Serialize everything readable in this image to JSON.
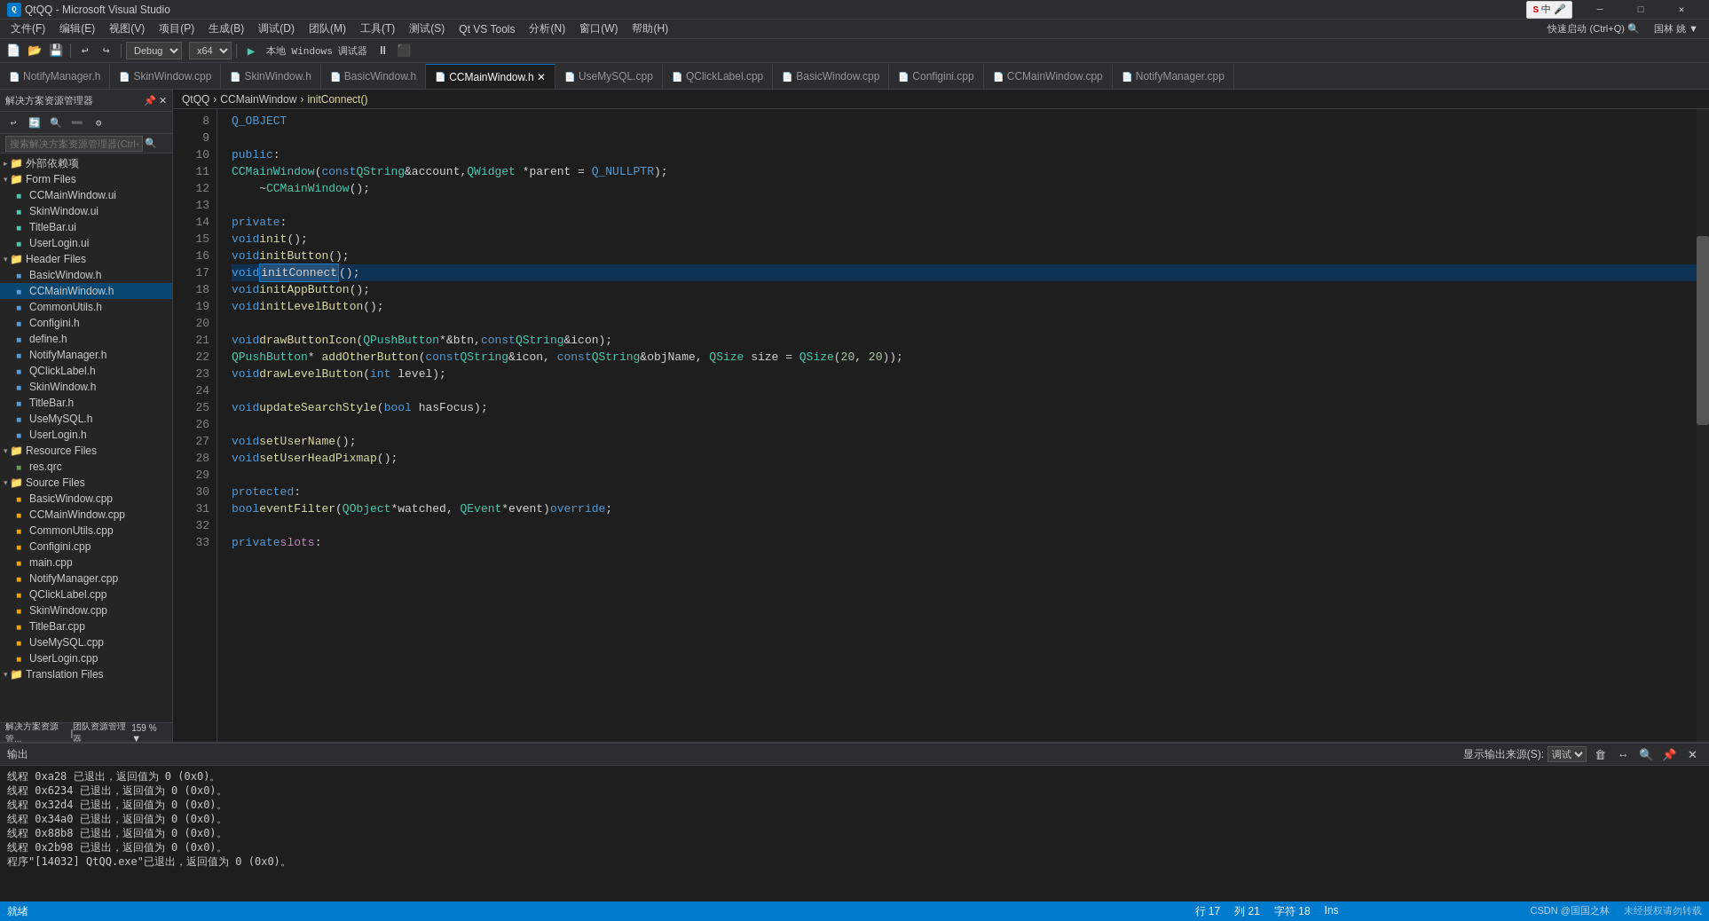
{
  "window": {
    "title": "QtQQ - Microsoft Visual Studio",
    "app_name": "QtQQ - Microsoft Visual Studio"
  },
  "title_bar": {
    "icon_text": "Q",
    "title": "QtQQ - Microsoft Visual Studio",
    "min_btn": "─",
    "max_btn": "□",
    "close_btn": "✕"
  },
  "menu_bar": {
    "items": [
      "文件(F)",
      "编辑(E)",
      "视图(V)",
      "项目(P)",
      "生成(B)",
      "调试(D)",
      "团队(M)",
      "工具(T)",
      "测试(S)",
      "Qt VS Tools",
      "分析(N)",
      "窗口(W)",
      "帮助(H)"
    ]
  },
  "toolbar": {
    "config": "Debug",
    "platform": "x64",
    "run_btn": "▶",
    "run_label": "本地 Windows 调试器"
  },
  "tabs": [
    {
      "label": "NotifyManager.h",
      "active": false,
      "modified": false
    },
    {
      "label": "SkinWindow.cpp",
      "active": false,
      "modified": false
    },
    {
      "label": "SkinWindow.h",
      "active": false,
      "modified": false
    },
    {
      "label": "BasicWindow.h",
      "active": false,
      "modified": false
    },
    {
      "label": "CCMainWindow.h",
      "active": true,
      "modified": true
    },
    {
      "label": "UseMySQL.cpp",
      "active": false,
      "modified": false
    },
    {
      "label": "QClickLabel.cpp",
      "active": false,
      "modified": false
    },
    {
      "label": "BasicWindow.cpp",
      "active": false,
      "modified": false
    },
    {
      "label": "Configini.cpp",
      "active": false,
      "modified": false
    },
    {
      "label": "CCMainWindow.cpp",
      "active": false,
      "modified": false
    },
    {
      "label": "NotifyManager.cpp",
      "active": false,
      "modified": false
    }
  ],
  "breadcrumb": {
    "project": "QtQQ",
    "class": "CCMainWindow",
    "method": "initConnect()"
  },
  "sidebar": {
    "title": "解决方案资源管理器",
    "search_placeholder": "搜索解决方案资源管理器(Ctrl+;)",
    "tree": [
      {
        "level": 0,
        "icon": "▸",
        "label": "外部依赖项",
        "expanded": false
      },
      {
        "level": 0,
        "icon": "▾",
        "label": "Form Files",
        "expanded": true
      },
      {
        "level": 1,
        "icon": "📄",
        "label": "CCMainWindow.ui",
        "is_file": true
      },
      {
        "level": 1,
        "icon": "📄",
        "label": "SkinWindow.ui",
        "is_file": true
      },
      {
        "level": 1,
        "icon": "📄",
        "label": "TitleBar.ui",
        "is_file": true
      },
      {
        "level": 1,
        "icon": "📄",
        "label": "UserLogin.ui",
        "is_file": true
      },
      {
        "level": 0,
        "icon": "▾",
        "label": "Header Files",
        "expanded": true
      },
      {
        "level": 1,
        "icon": "📄",
        "label": "BasicWindow.h",
        "is_file": true
      },
      {
        "level": 1,
        "icon": "📄",
        "label": "CCMainWindow.h",
        "is_file": true,
        "selected": true
      },
      {
        "level": 1,
        "icon": "📄",
        "label": "CommonUtils.h",
        "is_file": true
      },
      {
        "level": 1,
        "icon": "📄",
        "label": "Configini.h",
        "is_file": true
      },
      {
        "level": 1,
        "icon": "📄",
        "label": "define.h",
        "is_file": true
      },
      {
        "level": 1,
        "icon": "📄",
        "label": "NotifyManager.h",
        "is_file": true
      },
      {
        "level": 1,
        "icon": "📄",
        "label": "QClickLabel.h",
        "is_file": true
      },
      {
        "level": 1,
        "icon": "📄",
        "label": "SkinWindow.h",
        "is_file": true
      },
      {
        "level": 1,
        "icon": "📄",
        "label": "TitleBar.h",
        "is_file": true
      },
      {
        "level": 1,
        "icon": "📄",
        "label": "UseMySQL.h",
        "is_file": true
      },
      {
        "level": 1,
        "icon": "📄",
        "label": "UserLogin.h",
        "is_file": true
      },
      {
        "level": 0,
        "icon": "▾",
        "label": "Resource Files",
        "expanded": true
      },
      {
        "level": 1,
        "icon": "📄",
        "label": "res.qrc",
        "is_file": true
      },
      {
        "level": 0,
        "icon": "▾",
        "label": "Source Files",
        "expanded": true
      },
      {
        "level": 1,
        "icon": "📄",
        "label": "BasicWindow.cpp",
        "is_file": true
      },
      {
        "level": 1,
        "icon": "📄",
        "label": "CCMainWindow.cpp",
        "is_file": true
      },
      {
        "level": 1,
        "icon": "📄",
        "label": "CommonUtils.cpp",
        "is_file": true
      },
      {
        "level": 1,
        "icon": "📄",
        "label": "Configini.cpp",
        "is_file": true
      },
      {
        "level": 1,
        "icon": "📄",
        "label": "main.cpp",
        "is_file": true
      },
      {
        "level": 1,
        "icon": "📄",
        "label": "NotifyManager.cpp",
        "is_file": true
      },
      {
        "level": 1,
        "icon": "📄",
        "label": "QClickLabel.cpp",
        "is_file": true
      },
      {
        "level": 1,
        "icon": "📄",
        "label": "SkinWindow.cpp",
        "is_file": true
      },
      {
        "level": 1,
        "icon": "📄",
        "label": "TitleBar.cpp",
        "is_file": true
      },
      {
        "level": 1,
        "icon": "📄",
        "label": "UseMySQL.cpp",
        "is_file": true
      },
      {
        "level": 1,
        "icon": "📄",
        "label": "UserLogin.cpp",
        "is_file": true
      },
      {
        "level": 0,
        "icon": "▾",
        "label": "Translation Files",
        "expanded": true
      }
    ],
    "bottom_tabs": [
      "解决方案资源管...",
      "团队资源管理器"
    ],
    "zoom": "159 %"
  },
  "code": {
    "lines": [
      {
        "num": 8,
        "content": "    Q_OBJECT"
      },
      {
        "num": 9,
        "content": ""
      },
      {
        "num": 10,
        "content": "public:"
      },
      {
        "num": 11,
        "content": "    CCMainWindow(const QString&account,QWidget *parent = Q_NULLPTR);"
      },
      {
        "num": 12,
        "content": "    ~CCMainWindow();"
      },
      {
        "num": 13,
        "content": ""
      },
      {
        "num": 14,
        "content": "private:"
      },
      {
        "num": 15,
        "content": "    void init();"
      },
      {
        "num": 16,
        "content": "    void initButton();"
      },
      {
        "num": 17,
        "content": "    void initConnect();",
        "highlighted": true,
        "selected_fn": "initConnect"
      },
      {
        "num": 18,
        "content": "    void initAppButton();"
      },
      {
        "num": 19,
        "content": "    void initLevelButton();"
      },
      {
        "num": 20,
        "content": ""
      },
      {
        "num": 21,
        "content": "    void drawButtonIcon(QPushButton*&btn,const QString&icon);"
      },
      {
        "num": 22,
        "content": "    QPushButton* addOtherButton(const QString&icon, const QString&objName, QSize size = QSize(20, 20));"
      },
      {
        "num": 23,
        "content": "    void drawLevelButton(int level);"
      },
      {
        "num": 24,
        "content": ""
      },
      {
        "num": 25,
        "content": "    void updateSearchStyle(bool hasFocus);"
      },
      {
        "num": 26,
        "content": ""
      },
      {
        "num": 27,
        "content": "    void setUserName();"
      },
      {
        "num": 28,
        "content": "    void setUserHeadPixmap();"
      },
      {
        "num": 29,
        "content": ""
      },
      {
        "num": 30,
        "content": "protected:"
      },
      {
        "num": 31,
        "content": "    bool eventFilter(QObject*watched, QEvent*event)override;"
      },
      {
        "num": 32,
        "content": ""
      },
      {
        "num": 33,
        "content": "private slots:"
      }
    ]
  },
  "output_panel": {
    "title": "输出",
    "source_label": "显示输出来源(S):",
    "source_value": "调试",
    "lines": [
      "线程 0xa28 已退出，返回值为 0 (0x0)。",
      "线程 0x6234 已退出，返回值为 0 (0x0)。",
      "线程 0x32d4 已退出，返回值为 0 (0x0)。",
      "线程 0x34a0 已退出，返回值为 0 (0x0)。",
      "线程 0x88b8 已退出，返回值为 0 (0x0)。",
      "线程 0x2b98 已退出，返回值为 0 (0x0)。",
      "程序\"[14032] QtQQ.exe\"已退出，返回值为 0 (0x0)。"
    ]
  },
  "status_bar": {
    "message": "就绪",
    "line": "行 17",
    "col": "列 21",
    "char": "字符 18",
    "mode": "Ins",
    "watermark": "CSDN @国国之林",
    "copyright": "未经授权请勿转载"
  }
}
